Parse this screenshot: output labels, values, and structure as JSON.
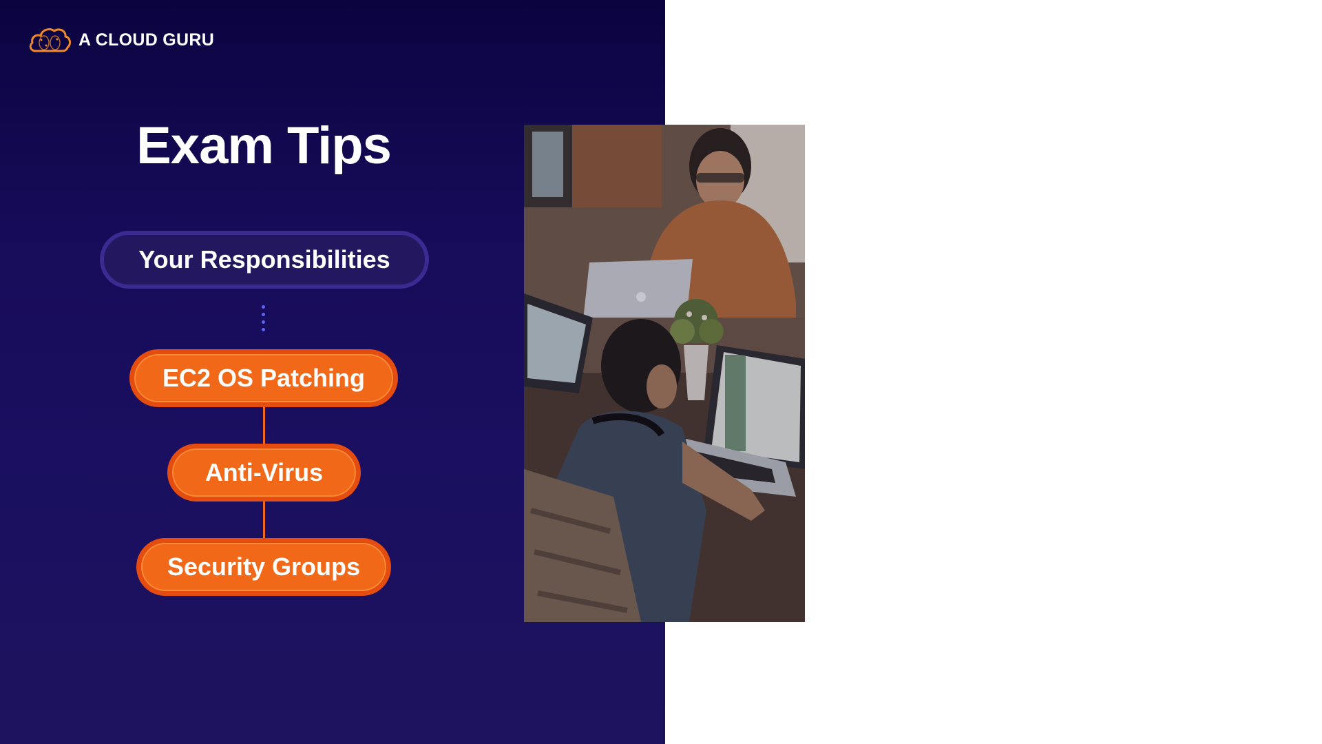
{
  "brand": {
    "name": "A CLOUD GURU",
    "logo_icon": "cloud-logo-icon",
    "accent": "#f06818"
  },
  "slide": {
    "title": "Exam Tips",
    "section_label": "Your Responsibilities",
    "items": [
      {
        "label": "EC2 OS Patching"
      },
      {
        "label": "Anti-Virus"
      },
      {
        "label": "Security Groups"
      }
    ]
  },
  "colors": {
    "background_top": "#0b0340",
    "background_bottom": "#1d135e",
    "pill_orange": "#f06818",
    "pill_dark": "#23175f"
  },
  "photo": {
    "icon": "office-photo-image"
  }
}
